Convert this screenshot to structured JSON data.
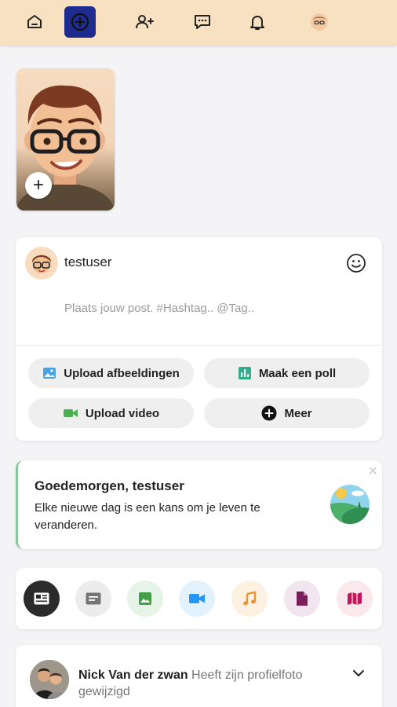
{
  "nav": {
    "items": [
      {
        "icon": "home-icon"
      },
      {
        "icon": "add-circle-icon",
        "active": true
      },
      {
        "icon": "add-user-icon"
      },
      {
        "icon": "chat-icon"
      },
      {
        "icon": "bell-icon"
      },
      {
        "icon": "profile-avatar"
      }
    ]
  },
  "story": {
    "add_icon": "+"
  },
  "composer": {
    "username": "testuser",
    "placeholder": "Plaats jouw post. #Hashtag.. @Tag..",
    "buttons": {
      "upload_images": "Upload afbeeldingen",
      "poll": "Maak een poll",
      "upload_video": "Upload video",
      "more": "Meer"
    }
  },
  "greeting": {
    "title": "Goedemorgen, testuser",
    "text": "Elke nieuwe dag is een kans om je leven te veranderen.",
    "close": "×"
  },
  "filters": [
    {
      "icon": "news-feed-icon",
      "active": true
    },
    {
      "icon": "text-post-icon"
    },
    {
      "icon": "image-icon"
    },
    {
      "icon": "video-icon"
    },
    {
      "icon": "music-icon"
    },
    {
      "icon": "file-icon"
    },
    {
      "icon": "map-icon"
    }
  ],
  "feed": {
    "name": "Nick Van der zwan",
    "action": " Heeft zijn profielfoto gewijzigd"
  },
  "colors": {
    "topbar": "#f8e1c0",
    "active_nav": "#1e2c8f",
    "greeting_border": "#8bc59a"
  }
}
